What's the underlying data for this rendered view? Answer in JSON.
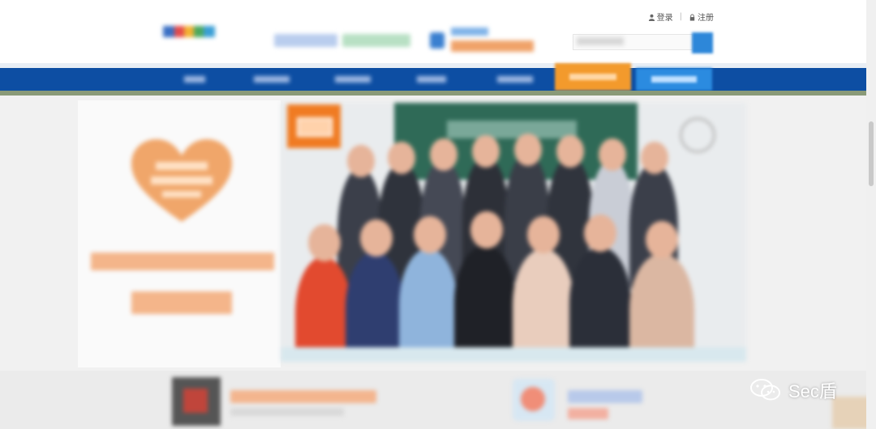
{
  "header": {
    "login_label": "登录",
    "register_label": "注册",
    "separator": "|",
    "icons": [
      "user-icon",
      "lock-icon",
      "search-icon"
    ]
  },
  "nav": {
    "item_count": 8,
    "active_index": 6,
    "colors": {
      "bar": "#0d4ea3",
      "active": "#f39a2c",
      "alt": "#2b8be0"
    }
  },
  "watermark": {
    "text": "Sec盾",
    "icon": "wechat-icon"
  },
  "colors": {
    "accent_orange": "#f07b22",
    "brand_blue": "#0d4ea3",
    "promo_peach": "#f4b58a"
  }
}
